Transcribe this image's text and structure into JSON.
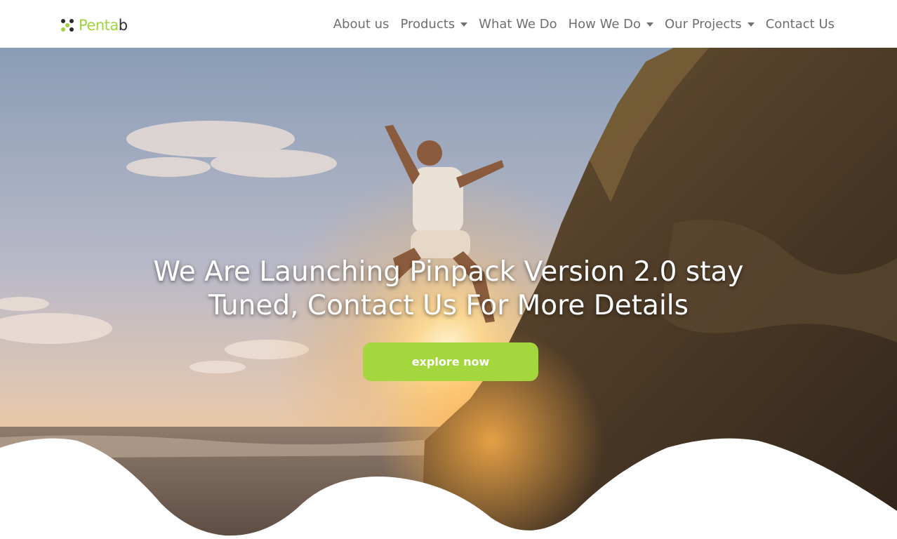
{
  "logo": {
    "text_light": "Penta",
    "text_dark": "b",
    "icon": "dots-logo-icon"
  },
  "nav": {
    "items": [
      {
        "label": "About us",
        "dropdown": false
      },
      {
        "label": "Products",
        "dropdown": true
      },
      {
        "label": "What We Do",
        "dropdown": false
      },
      {
        "label": "How We Do",
        "dropdown": true
      },
      {
        "label": "Our Projects",
        "dropdown": true
      },
      {
        "label": "Contact Us",
        "dropdown": false
      }
    ]
  },
  "hero": {
    "headline_line1": "We Are Launching Pinpack Version 2.0 stay",
    "headline_line2": "Tuned, Contact Us For More Details",
    "cta_label": "explore now",
    "image": "man-jumping-off-cliff-at-sunset-beach"
  },
  "colors": {
    "accent": "#a4d63e",
    "nav_text": "#6f6f6f",
    "background": "#ffffff"
  }
}
